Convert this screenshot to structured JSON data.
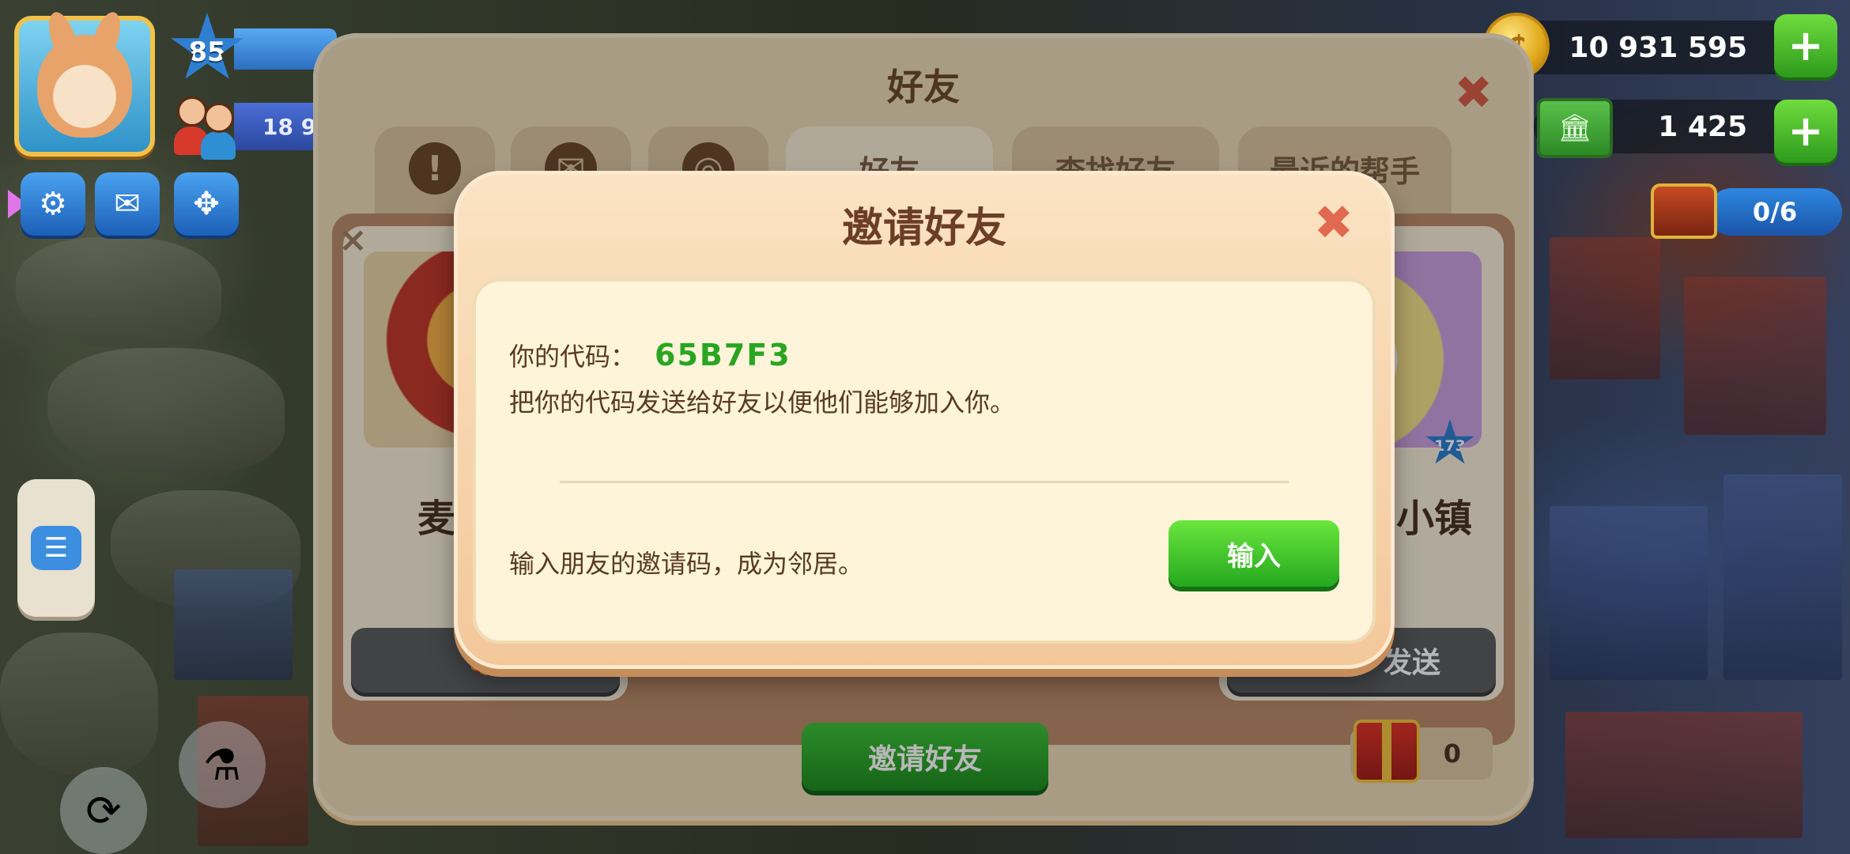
{
  "hud": {
    "player_level": "85",
    "population": "18 9",
    "coins": "10 931 595",
    "cash": "1 425",
    "chest_progress": "0/6"
  },
  "friends_panel": {
    "title": "好友",
    "tabs": [
      {
        "label": "",
        "icon": "alert-icon"
      },
      {
        "label": "",
        "icon": "mail-icon"
      },
      {
        "label": "",
        "icon": "target-icon"
      },
      {
        "label": "好友",
        "icon": ""
      },
      {
        "label": "查找好友",
        "icon": ""
      },
      {
        "label": "最近的帮手",
        "icon": ""
      }
    ],
    "cards": [
      {
        "name": "麦",
        "button": ""
      },
      {
        "name": "小镇",
        "button": "发送",
        "level": "173"
      }
    ],
    "invite_button": "邀请好友",
    "gift_count": "0"
  },
  "invite_modal": {
    "title": "邀请好友",
    "code_label": "你的代码：",
    "code_value": "65B7F3",
    "code_description": "把你的代码发送给好友以便他们能够加入你。",
    "enter_description": "输入朋友的邀请码，成为邻居。",
    "enter_button": "输入"
  },
  "colors": {
    "code_green": "#2aa521",
    "modal_bg": "#fdf4d9",
    "primary_button": "#24a81e",
    "close_red": "#e0694f"
  }
}
